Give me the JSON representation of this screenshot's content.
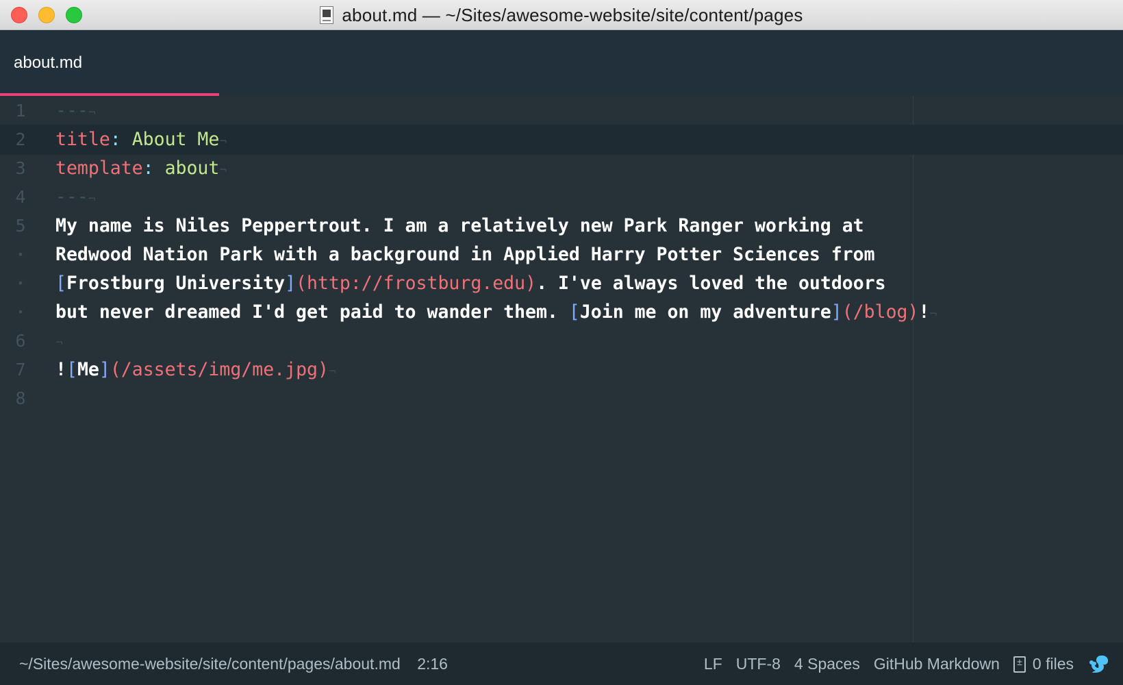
{
  "window": {
    "title": "about.md — ~/Sites/awesome-website/site/content/pages"
  },
  "tabs": [
    {
      "label": "about.md",
      "active": true
    }
  ],
  "editor": {
    "gutter": [
      "1",
      "2",
      "3",
      "4",
      "5",
      "•",
      "•",
      "•",
      "6",
      "7",
      "8"
    ],
    "lines": {
      "l1": {
        "dashes": "---"
      },
      "l2": {
        "key": "title",
        "colon": ":",
        "value": " About Me"
      },
      "l3": {
        "key": "template",
        "colon": ":",
        "value": " about"
      },
      "l4": {
        "dashes": "---"
      },
      "l5": {
        "text": "My name is Niles Peppertrout. I am a relatively new Park Ranger working at"
      },
      "l5b": {
        "text": "Redwood Nation Park with a background in Applied Harry Potter Sciences from"
      },
      "l5c": {
        "open": "[",
        "link_text": "Frostburg University",
        "close": "]",
        "url_open": "(",
        "url": "http://frostburg.edu",
        "url_close": ")",
        "rest": ". I've always loved the outdoors"
      },
      "l5d": {
        "text": "but never dreamed I'd get paid to wander them. ",
        "open": "[",
        "link_text": "Join me on my adventure",
        "close": "]",
        "url_open": "(",
        "url": "/blog",
        "url_close": ")",
        "end": "!"
      },
      "l7": {
        "bang": "!",
        "open": "[",
        "alt": "Me",
        "close": "]",
        "url_open": "(",
        "url": "/assets/img/me.jpg",
        "url_close": ")"
      },
      "eol_marker": "¬"
    }
  },
  "status": {
    "path": "~/Sites/awesome-website/site/content/pages/about.md",
    "cursor": "2:16",
    "line_ending": "LF",
    "encoding": "UTF-8",
    "indent": "4 Spaces",
    "grammar": "GitHub Markdown",
    "files": "0 files"
  },
  "colors": {
    "accent": "#ec407a",
    "background": "#263238",
    "key": "#f07178",
    "string": "#c3e88d",
    "bracket": "#82aaff"
  },
  "icons": {
    "document": "document-icon",
    "git_file": "file-diff-icon",
    "squirrel": "squirrel-icon"
  }
}
